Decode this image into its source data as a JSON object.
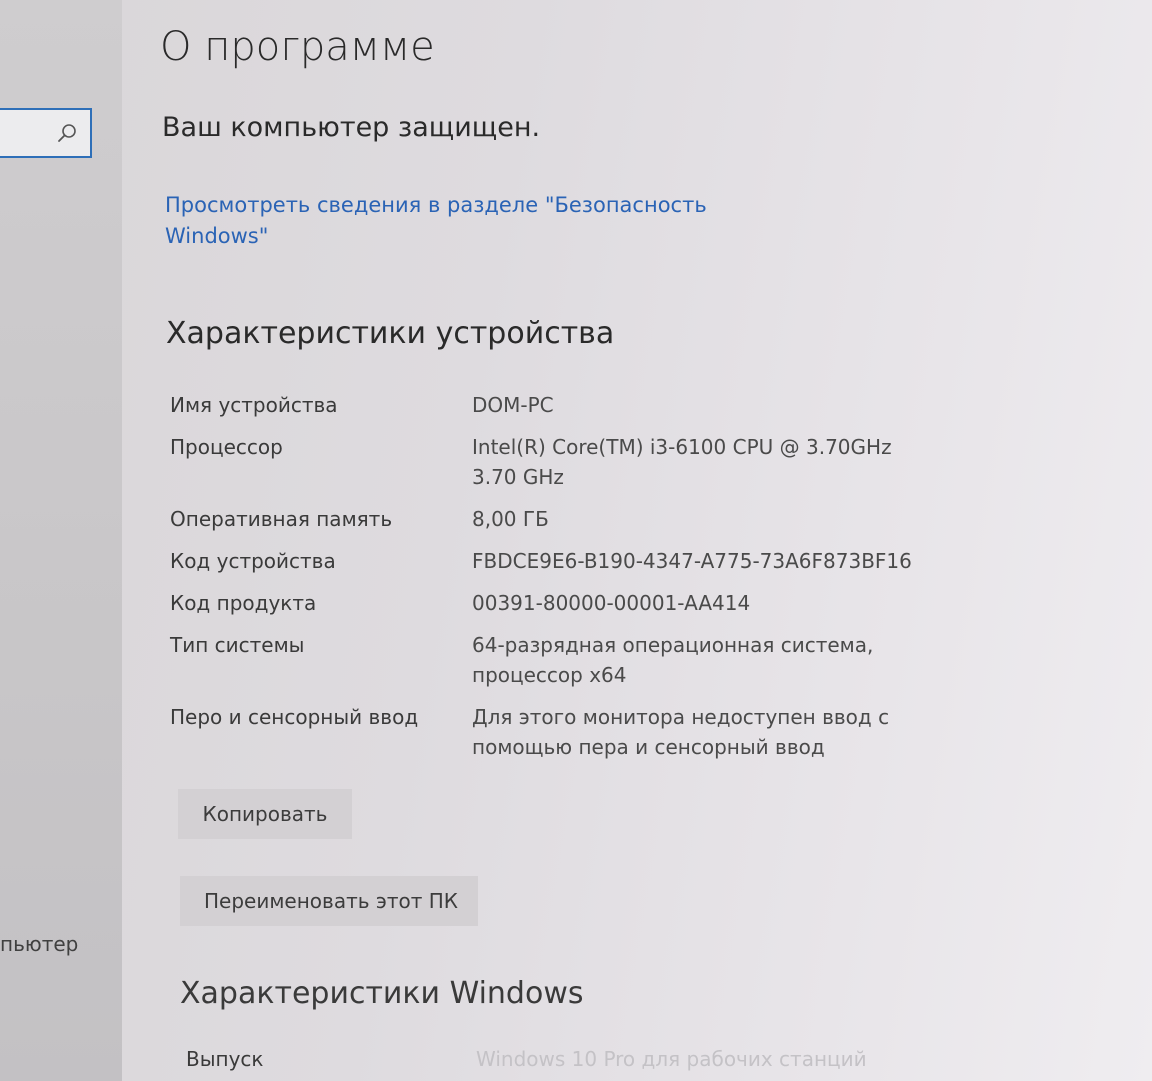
{
  "sidebar": {
    "search": {
      "placeholder": ""
    },
    "partial_item": "пьютер"
  },
  "page": {
    "title": "О программе",
    "protection_status": "Ваш компьютер защищен.",
    "security_link": "Просмотреть сведения в разделе \"Безопасность Windows\""
  },
  "device_specs": {
    "title": "Характеристики устройства",
    "rows": [
      {
        "label": "Имя устройства",
        "value": "DOM-PC"
      },
      {
        "label": "Процессор",
        "value": "Intel(R) Core(TM) i3-6100 CPU @ 3.70GHz 3.70 GHz"
      },
      {
        "label": "Оперативная память",
        "value": "8,00 ГБ"
      },
      {
        "label": "Код устройства",
        "value": "FBDCE9E6-B190-4347-A775-73A6F873BF16"
      },
      {
        "label": "Код продукта",
        "value": "00391-80000-00001-AA414"
      },
      {
        "label": "Тип системы",
        "value": "64-разрядная операционная система, процессор x64"
      },
      {
        "label": "Перо и сенсорный ввод",
        "value": "Для этого монитора недоступен ввод с помощью пера и сенсорный ввод"
      }
    ],
    "copy_label": "Копировать",
    "rename_label": "Переименовать этот ПК"
  },
  "windows_specs": {
    "title": "Характеристики Windows",
    "edition_label": "Выпуск",
    "edition_value": "Windows 10 Pro для рабочих станций"
  },
  "colors": {
    "link": "#2a63b5",
    "search_border": "#2e6fb8"
  }
}
